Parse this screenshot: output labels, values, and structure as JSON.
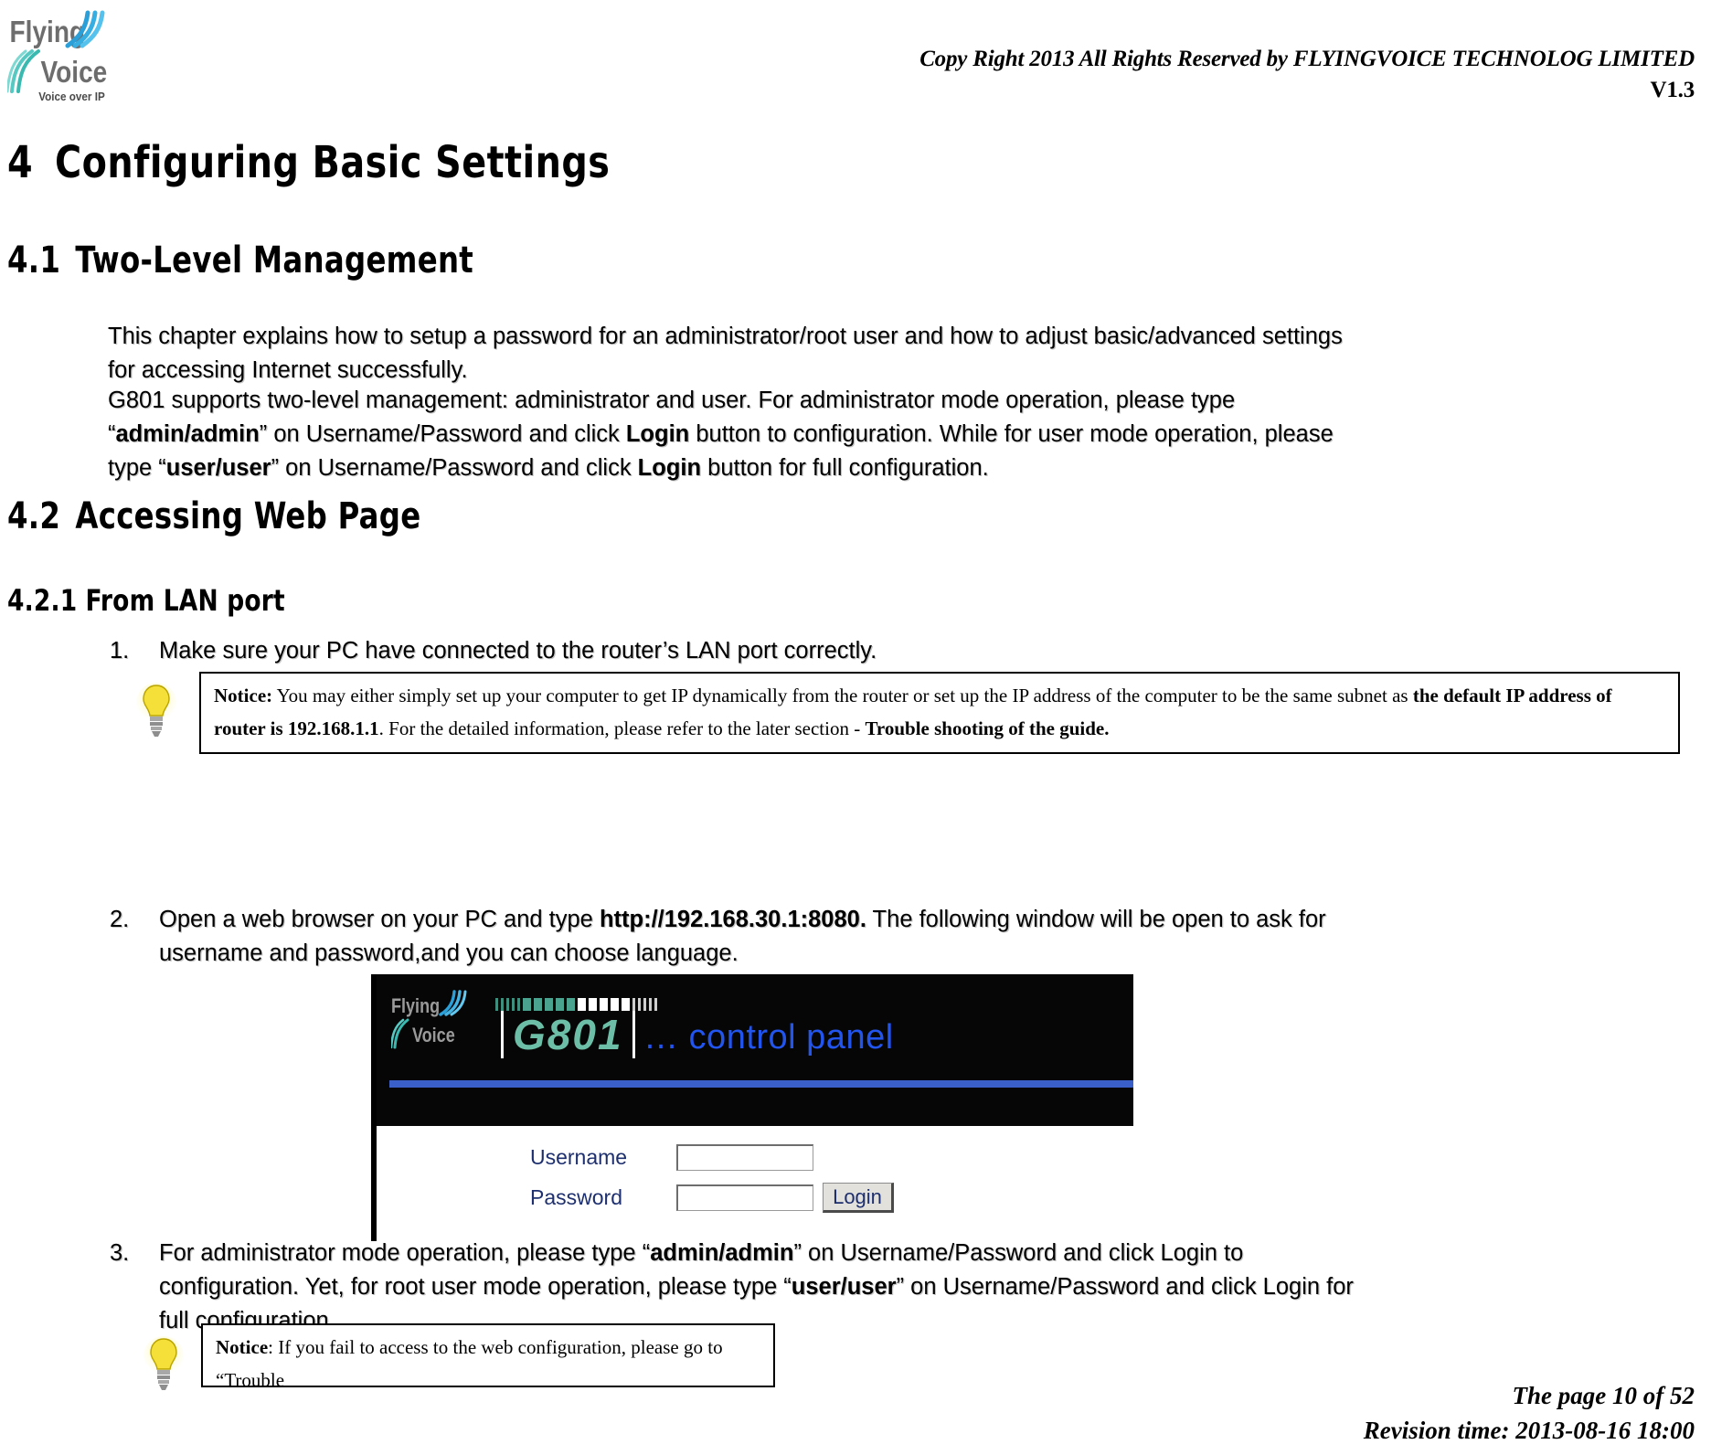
{
  "header": {
    "copyright": "Copy Right 2013 All Rights Reserved by FLYINGVOICE TECHNOLOG LIMITED",
    "version": "V1.3",
    "logo_name_top": "Flying",
    "logo_name_bottom": "Voice",
    "logo_tagline": "Voice over IP"
  },
  "sections": {
    "h1_num": "4",
    "h1_title": "Configuring Basic Settings",
    "h2_1_num": "4.1",
    "h2_1_title": "Two-Level Management",
    "h2_2_num": "4.2",
    "h2_2_title": "Accessing Web Page",
    "h3_1_num": "4.2.1",
    "h3_1_title": "From LAN port"
  },
  "paragraphs": {
    "intro": "This chapter explains how to setup a password for an administrator/root user and how to adjust basic/advanced settings for accessing Internet successfully.",
    "two_level_a": "G801 supports two-level management: administrator and user. For administrator mode operation, please type “",
    "two_level_admin": "admin/admin",
    "two_level_b": "” on Username/Password and click ",
    "two_level_login1": "Login",
    "two_level_c": " button to configuration. While for user mode operation, please type “",
    "two_level_user": "user/user",
    "two_level_d": "” on Username/Password and click ",
    "two_level_login2": "Login",
    "two_level_e": " button for full configuration."
  },
  "list": {
    "item1_marker": "1.",
    "item1_text": "Make sure your PC have connected to the router’s LAN port correctly.",
    "item2_marker": "2.",
    "item2_a": "Open a web browser on your PC and type ",
    "item2_url": "http://192.168.30.1:8080.",
    "item2_b": " The following window will be open to ask for username and password,and you can choose language.",
    "item3_marker": "3.",
    "item3_a": "For administrator mode operation, please type “",
    "item3_admin": "admin/admin",
    "item3_b": "” on Username/Password and click Login to configuration. Yet, for root user mode operation, please type “",
    "item3_user": "user/user",
    "item3_c": "” on Username/Password and click Login for full configuration."
  },
  "notice1": {
    "label": "Notice:",
    "text_a": " You may either simply set up your computer to get IP dynamically from the router or set up the IP address of the computer to be the same subnet as ",
    "bold_a": "the default IP address of router is 192.168.1.1",
    "text_b": ". For the detailed information, please refer to the later section - ",
    "bold_b": "Trouble shooting of the guide."
  },
  "notice2": {
    "label": "Notice",
    "text": ": If you fail to access to the web configuration, please go to “Trouble"
  },
  "control_panel": {
    "model": "G801",
    "title": "… control panel",
    "logo_top": "Flying",
    "logo_bottom": "Voice",
    "username_label": "Username",
    "password_label": "Password",
    "username_value": "",
    "password_value": "",
    "login_label": "Login",
    "accent_teal": "#6cbfa6",
    "accent_blue": "#2255ee",
    "rule_blue": "#3a5fc8",
    "banner_bg": "#060606"
  },
  "footer": {
    "page": "The page 10 of 52",
    "revision": "Revision time: 2013-08-16 18:00"
  }
}
